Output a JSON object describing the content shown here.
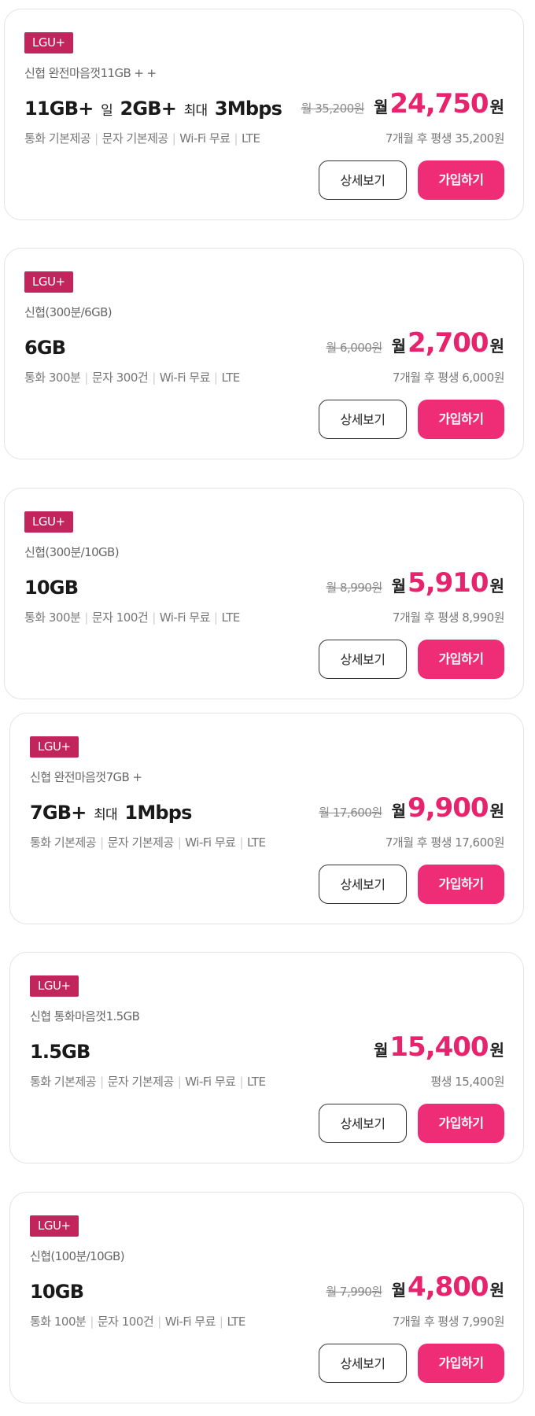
{
  "plans": [
    {
      "carrier": "LGU+",
      "name": "신협 완전마음껏11GB + +",
      "title_main": "11GB+",
      "title_extra": [
        {
          "small": "일",
          "big": "2GB+"
        },
        {
          "small": "최대",
          "big": "3Mbps"
        }
      ],
      "specs": [
        "통화 기본제공",
        "문자 기본제공",
        "Wi-Fi 무료",
        "LTE"
      ],
      "original_price": "월 35,200원",
      "month_label": "월",
      "price": "24,750",
      "won": "원",
      "after_text": "7개월 후 평생 35,200원",
      "detail_label": "상세보기",
      "join_label": "가입하기"
    },
    {
      "carrier": "LGU+",
      "name": "신협(300분/6GB)",
      "title_main": "6GB",
      "title_extra": [],
      "specs": [
        "통화 300분",
        "문자 300건",
        "Wi-Fi 무료",
        "LTE"
      ],
      "original_price": "월 6,000원",
      "month_label": "월",
      "price": "2,700",
      "won": "원",
      "after_text": "7개월 후 평생 6,000원",
      "detail_label": "상세보기",
      "join_label": "가입하기"
    },
    {
      "carrier": "LGU+",
      "name": "신협(300분/10GB)",
      "title_main": "10GB",
      "title_extra": [],
      "specs": [
        "통화 300분",
        "문자 100건",
        "Wi-Fi 무료",
        "LTE"
      ],
      "original_price": "월 8,990원",
      "month_label": "월",
      "price": "5,910",
      "won": "원",
      "after_text": "7개월 후 평생 8,990원",
      "detail_label": "상세보기",
      "join_label": "가입하기"
    },
    {
      "carrier": "LGU+",
      "name": "신협 완전마음껏7GB +",
      "title_main": "7GB+",
      "title_extra": [
        {
          "small": "최대",
          "big": "1Mbps"
        }
      ],
      "specs": [
        "통화 기본제공",
        "문자 기본제공",
        "Wi-Fi 무료",
        "LTE"
      ],
      "original_price": "월 17,600원",
      "month_label": "월",
      "price": "9,900",
      "won": "원",
      "after_text": "7개월 후 평생 17,600원",
      "detail_label": "상세보기",
      "join_label": "가입하기"
    },
    {
      "carrier": "LGU+",
      "name": "신협 통화마음껏1.5GB",
      "title_main": "1.5GB",
      "title_extra": [],
      "specs": [
        "통화 기본제공",
        "문자 기본제공",
        "Wi-Fi 무료",
        "LTE"
      ],
      "original_price": "",
      "month_label": "월",
      "price": "15,400",
      "won": "원",
      "after_text": "평생 15,400원",
      "detail_label": "상세보기",
      "join_label": "가입하기"
    },
    {
      "carrier": "LGU+",
      "name": "신협(100분/10GB)",
      "title_main": "10GB",
      "title_extra": [],
      "specs": [
        "통화 100분",
        "문자 100건",
        "Wi-Fi 무료",
        "LTE"
      ],
      "original_price": "월 7,990원",
      "month_label": "월",
      "price": "4,800",
      "won": "원",
      "after_text": "7개월 후 평생 7,990원",
      "detail_label": "상세보기",
      "join_label": "가입하기"
    }
  ]
}
